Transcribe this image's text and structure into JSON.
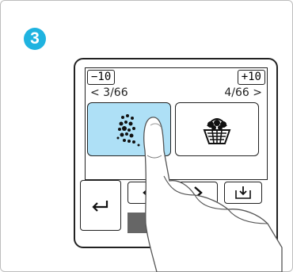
{
  "step": {
    "number": "3"
  },
  "pager": {
    "minus_label": "−10",
    "plus_label": "+10",
    "prev_page_text": "< 3/66",
    "next_page_text": "4/66 >"
  },
  "patterns": [
    {
      "name": "snowflake-pattern",
      "selected": true
    },
    {
      "name": "flower-basket-pattern",
      "selected": false
    }
  ],
  "icons": {
    "back": "return-arrow-icon",
    "prev": "chevron-left-icon",
    "next": "chevron-right-icon",
    "memory": "save-to-memory-icon",
    "embroidery": "embroidery-hoop-icon"
  },
  "colors": {
    "step_badge": "#1fb3e0",
    "selected_tile": "#aee0f6",
    "tab_bg": "#666666"
  }
}
